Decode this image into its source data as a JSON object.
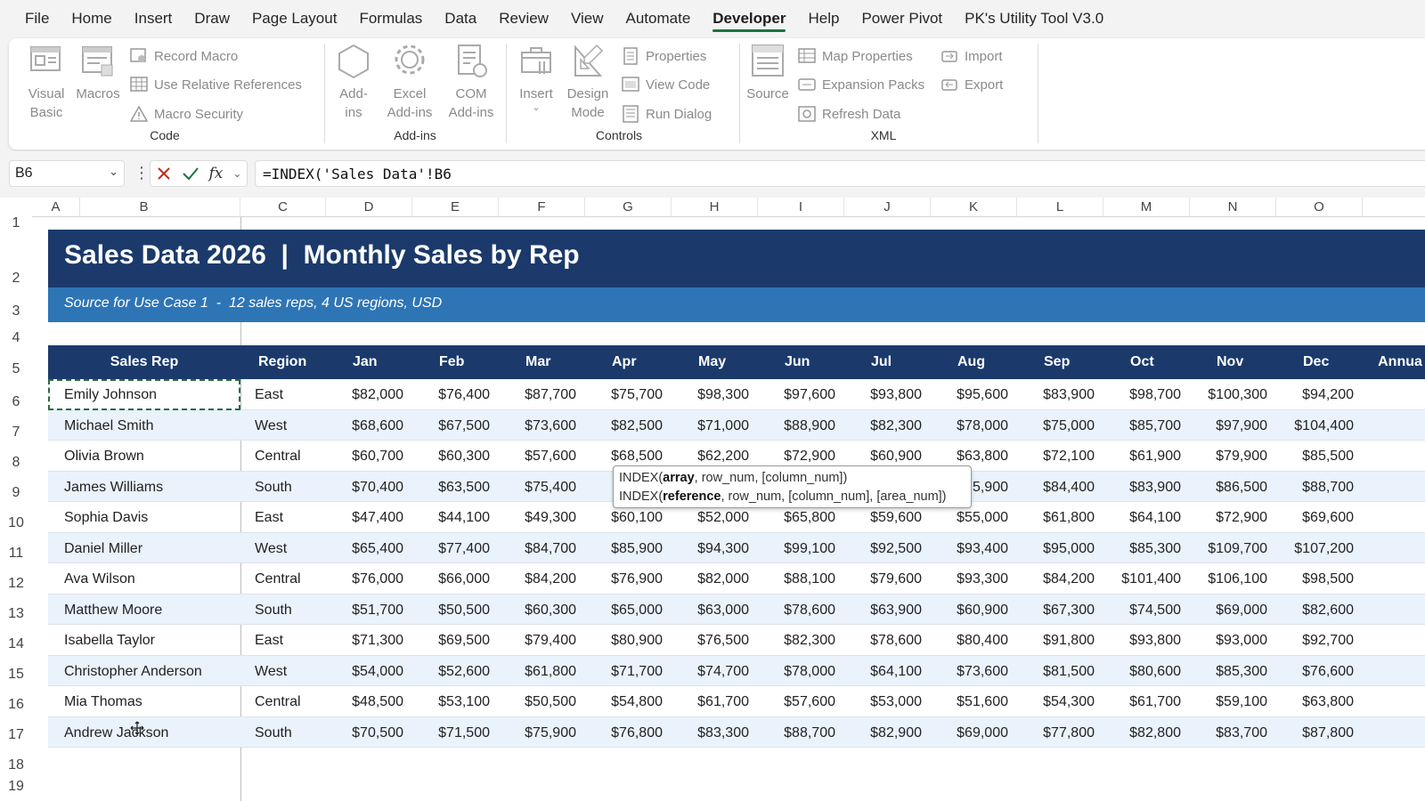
{
  "menu": [
    "File",
    "Home",
    "Insert",
    "Draw",
    "Page Layout",
    "Formulas",
    "Data",
    "Review",
    "View",
    "Automate",
    "Developer",
    "Help",
    "Power Pivot",
    "PK's Utility Tool V3.0"
  ],
  "active_menu": "Developer",
  "ribbon": {
    "code": {
      "label": "Code",
      "visual_basic": "Visual Basic",
      "macros": "Macros",
      "record_macro": "Record Macro",
      "use_relative": "Use Relative References",
      "macro_security": "Macro Security"
    },
    "addins": {
      "label": "Add-ins",
      "addins": "Add-ins",
      "excel_addins": "Excel Add-ins",
      "com_addins": "COM Add-ins"
    },
    "controls": {
      "label": "Controls",
      "insert": "Insert",
      "design_mode": "Design Mode",
      "properties": "Properties",
      "view_code": "View Code",
      "run_dialog": "Run Dialog"
    },
    "xml": {
      "label": "XML",
      "source": "Source",
      "map_properties": "Map Properties",
      "expansion_packs": "Expansion Packs",
      "refresh_data": "Refresh Data",
      "import": "Import",
      "export": "Export"
    }
  },
  "formula_bar": {
    "name_box": "B6",
    "formula": "=INDEX('Sales Data'!B6"
  },
  "columns": [
    "A",
    "B",
    "C",
    "D",
    "E",
    "F",
    "G",
    "H",
    "I",
    "J",
    "K",
    "L",
    "M",
    "N",
    "O"
  ],
  "rows": [
    "1",
    "2",
    "3",
    "4",
    "5",
    "6",
    "7",
    "8",
    "9",
    "10",
    "11",
    "12",
    "13",
    "14",
    "15",
    "16",
    "17",
    "18",
    "19"
  ],
  "sheet": {
    "title": "Sales Data 2026  |  Monthly Sales by Rep",
    "subtitle": "Source for Use Case 1  -  12 sales reps, 4 US regions, USD",
    "headers": [
      "Sales Rep",
      "Region",
      "Jan",
      "Feb",
      "Mar",
      "Apr",
      "May",
      "Jun",
      "Jul",
      "Aug",
      "Sep",
      "Oct",
      "Nov",
      "Dec",
      "Annua"
    ],
    "data": [
      [
        "Emily Johnson",
        "East",
        "$82,000",
        "$76,400",
        "$87,700",
        "$75,700",
        "$98,300",
        "$97,600",
        "$93,800",
        "$95,600",
        "$83,900",
        "$98,700",
        "$100,300",
        "$94,200"
      ],
      [
        "Michael Smith",
        "West",
        "$68,600",
        "$67,500",
        "$73,600",
        "$82,500",
        "$71,000",
        "$88,900",
        "$82,300",
        "$78,000",
        "$75,000",
        "$85,700",
        "$97,900",
        "$104,400"
      ],
      [
        "Olivia Brown",
        "Central",
        "$60,700",
        "$60,300",
        "$57,600",
        "$68,500",
        "$62,200",
        "$72,900",
        "$60,900",
        "$63,800",
        "$72,100",
        "$61,900",
        "$79,900",
        "$85,500"
      ],
      [
        "James Williams",
        "South",
        "$70,400",
        "$63,500",
        "$75,400",
        "",
        "",
        "",
        "",
        "$75,900",
        "$84,400",
        "$83,900",
        "$86,500",
        "$88,700"
      ],
      [
        "Sophia Davis",
        "East",
        "$47,400",
        "$44,100",
        "$49,300",
        "$60,100",
        "$52,000",
        "$65,800",
        "$59,600",
        "$55,000",
        "$61,800",
        "$64,100",
        "$72,900",
        "$69,600"
      ],
      [
        "Daniel Miller",
        "West",
        "$65,400",
        "$77,400",
        "$84,700",
        "$85,900",
        "$94,300",
        "$99,100",
        "$92,500",
        "$93,400",
        "$95,000",
        "$85,300",
        "$109,700",
        "$107,200"
      ],
      [
        "Ava Wilson",
        "Central",
        "$76,000",
        "$66,000",
        "$84,200",
        "$76,900",
        "$82,000",
        "$88,100",
        "$79,600",
        "$93,300",
        "$84,200",
        "$101,400",
        "$106,100",
        "$98,500"
      ],
      [
        "Matthew Moore",
        "South",
        "$51,700",
        "$50,500",
        "$60,300",
        "$65,000",
        "$63,000",
        "$78,600",
        "$63,900",
        "$60,900",
        "$67,300",
        "$74,500",
        "$69,000",
        "$82,600"
      ],
      [
        "Isabella Taylor",
        "East",
        "$71,300",
        "$69,500",
        "$79,400",
        "$80,900",
        "$76,500",
        "$82,300",
        "$78,600",
        "$80,400",
        "$91,800",
        "$93,800",
        "$93,000",
        "$92,700"
      ],
      [
        "Christopher Anderson",
        "West",
        "$54,000",
        "$52,600",
        "$61,800",
        "$71,700",
        "$74,700",
        "$78,000",
        "$64,100",
        "$73,600",
        "$81,500",
        "$80,600",
        "$85,300",
        "$76,600"
      ],
      [
        "Mia Thomas",
        "Central",
        "$48,500",
        "$53,100",
        "$50,500",
        "$54,800",
        "$61,700",
        "$57,600",
        "$53,000",
        "$51,600",
        "$54,300",
        "$61,700",
        "$59,100",
        "$63,800"
      ],
      [
        "Andrew Jackson",
        "South",
        "$70,500",
        "$71,500",
        "$75,900",
        "$76,800",
        "$83,300",
        "$88,700",
        "$82,900",
        "$69,000",
        "$77,800",
        "$82,800",
        "$83,700",
        "$87,800"
      ]
    ]
  },
  "tooltip": {
    "line1_fn": "INDEX(",
    "line1_bold": "array",
    "line1_rest": ", row_num, [column_num])",
    "line2_fn": "INDEX(",
    "line2_bold": "reference",
    "line2_rest": ", row_num, [column_num], [area_num])"
  },
  "colors": {
    "banner": "#1b3a6b",
    "subbanner": "#2e75b6",
    "accent": "#1a7343",
    "alt_row": "#eaf2fb"
  }
}
